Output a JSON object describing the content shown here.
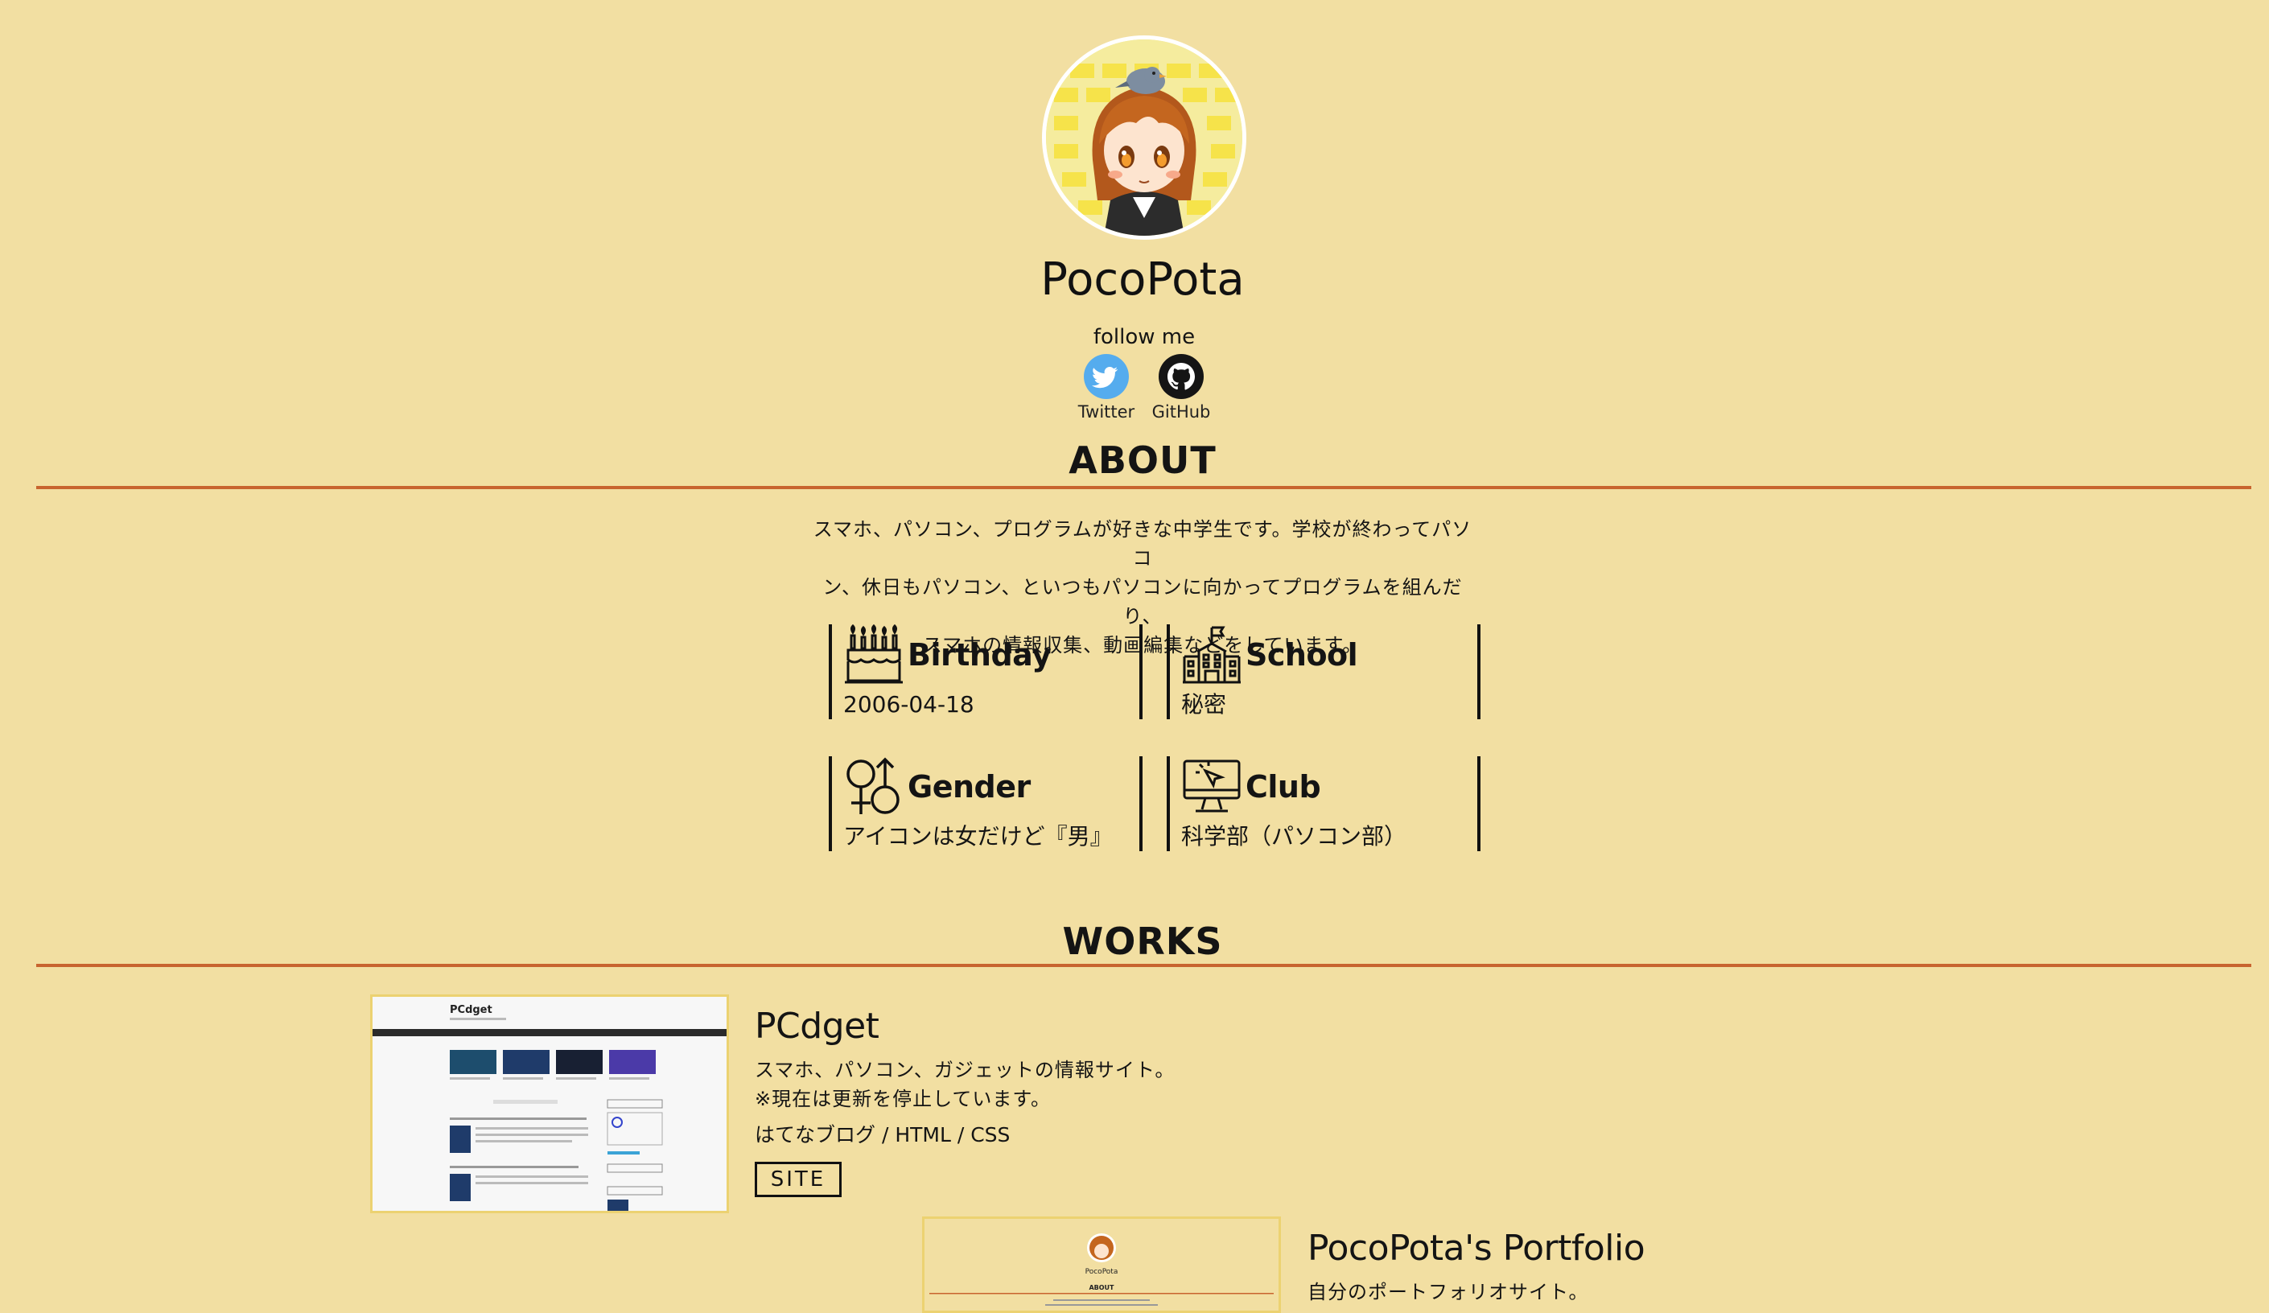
{
  "profile": {
    "name": "PocoPota",
    "follow_label": "follow me",
    "social": [
      {
        "label": "Twitter",
        "icon": "twitter-icon",
        "color": "#55acee"
      },
      {
        "label": "GitHub",
        "icon": "github-icon",
        "color": "#151515"
      }
    ]
  },
  "about": {
    "title": "ABOUT",
    "lines": [
      "スマホ、パソコン、プログラムが好きな中学生です。学校が終わってパソコ",
      "ン、休日もパソコン、といつもパソコンに向かってプログラムを組んだり、",
      "スマホの情報収集、動画編集などをしています。"
    ],
    "cards": [
      {
        "title": "Birthday",
        "value": "2006-04-18",
        "icon": "birthday-cake-icon"
      },
      {
        "title": "School",
        "value": "秘密",
        "icon": "school-building-icon"
      },
      {
        "title": "Gender",
        "value": "アイコンは女だけど『男』",
        "icon": "gender-icon"
      },
      {
        "title": "Club",
        "value": "科学部（パソコン部）",
        "icon": "computer-club-icon"
      }
    ]
  },
  "works": {
    "title": "WORKS",
    "items": [
      {
        "title": "PCdget",
        "desc_lines": [
          "スマホ、パソコン、ガジェットの情報サイト。",
          "※現在は更新を停止しています。"
        ],
        "tags": "はてなブログ / HTML / CSS",
        "button": "SITE",
        "thumb_title": "PCdget"
      },
      {
        "title": "PocoPota's Portfolio",
        "desc_lines": [
          "自分のポートフォリオサイト。"
        ],
        "thumb_title": "PocoPota",
        "thumb_heading": "ABOUT"
      }
    ]
  },
  "colors": {
    "background": "#f2dfa2",
    "accent_rule": "#c8642f",
    "text": "#141414",
    "thumb_border": "#ecd271"
  }
}
